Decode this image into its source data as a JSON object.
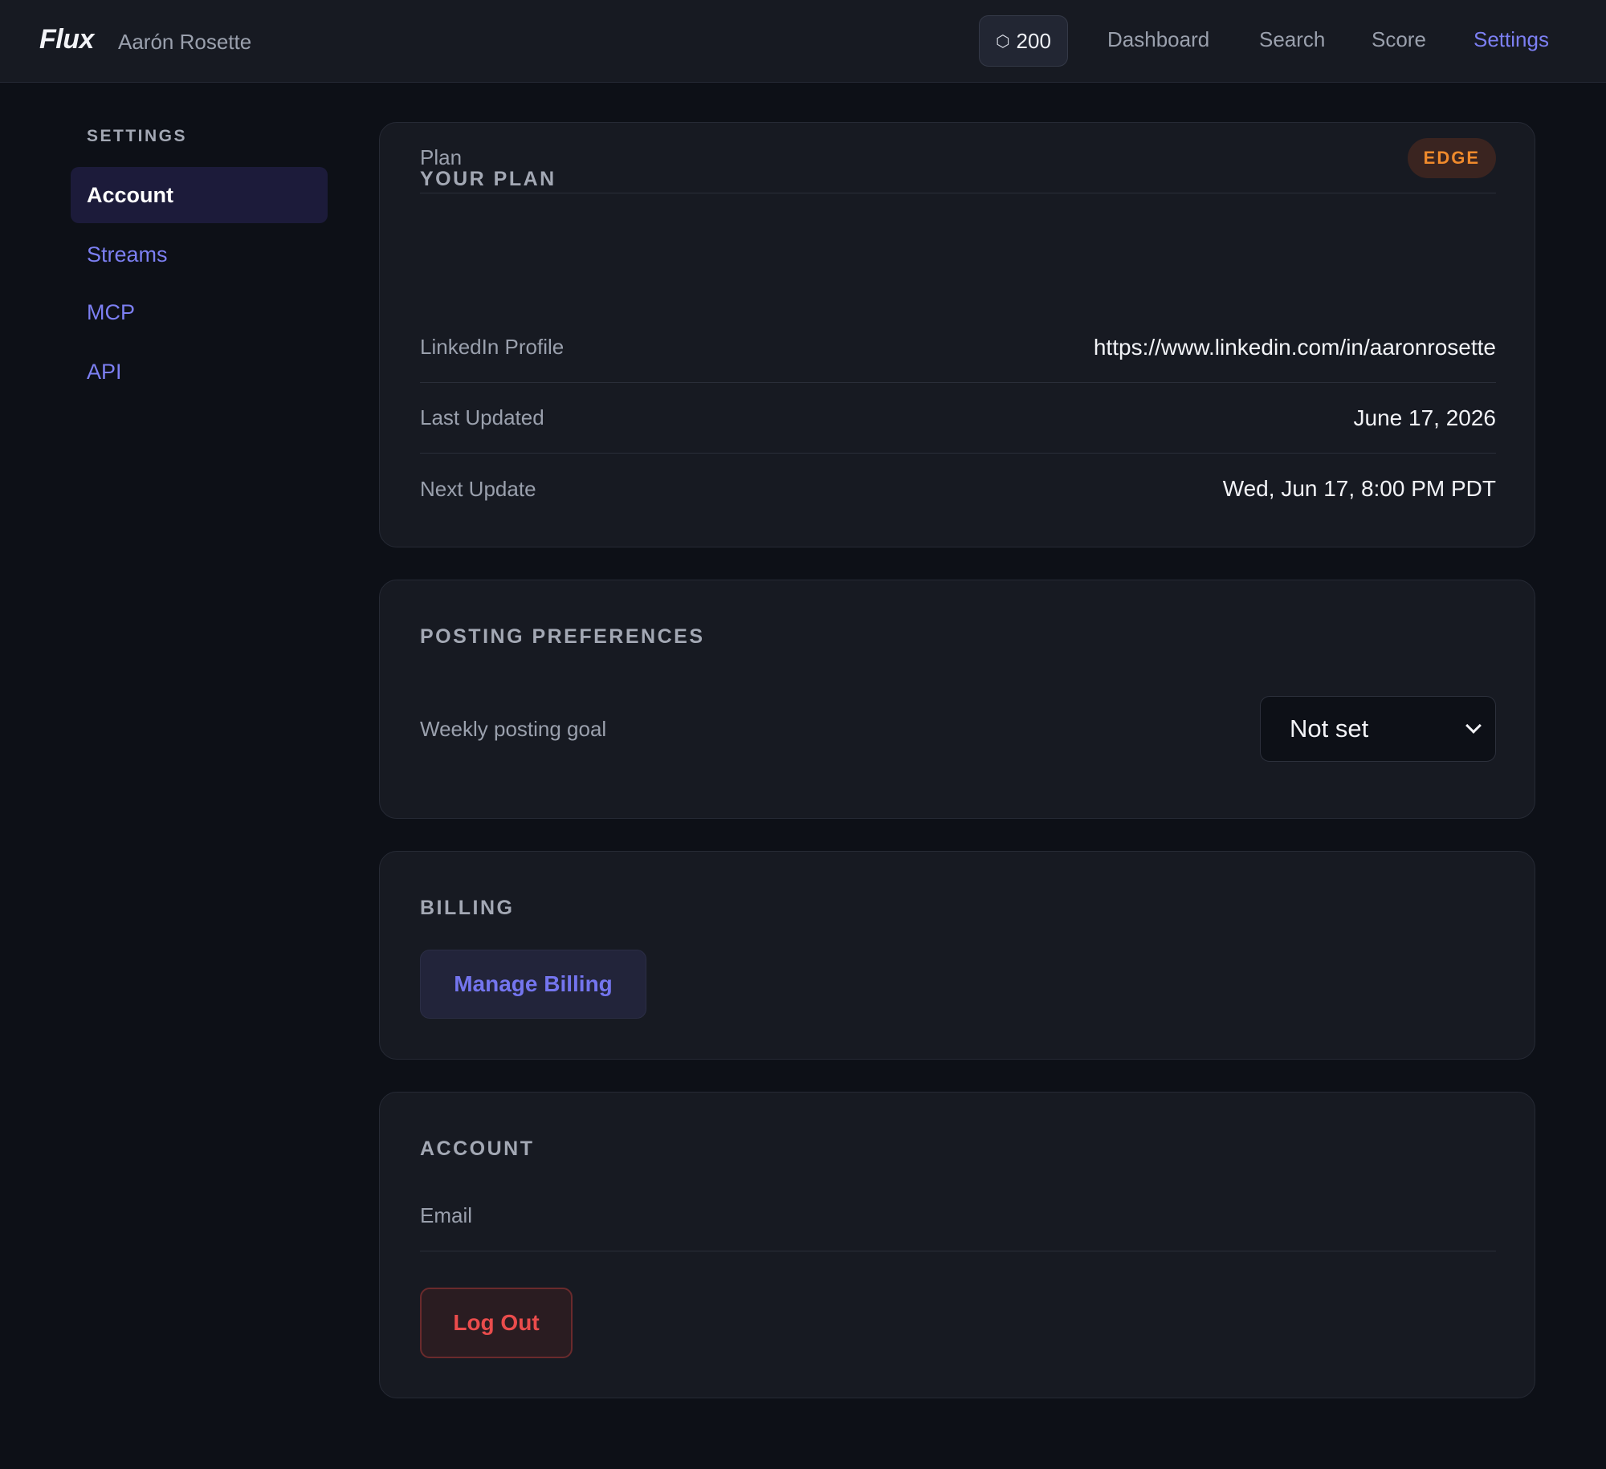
{
  "app": {
    "logo": "Flux",
    "username": "Aarón Rosette",
    "credits": "200",
    "credits_icon": "⬡"
  },
  "nav": {
    "dashboard": "Dashboard",
    "search": "Search",
    "score": "Score",
    "settings": "Settings"
  },
  "sidebar": {
    "heading": "SETTINGS",
    "items": [
      {
        "label": "Account",
        "active": true
      },
      {
        "label": "Streams",
        "active": false
      },
      {
        "label": "MCP",
        "active": false
      },
      {
        "label": "API",
        "active": false
      }
    ]
  },
  "plan": {
    "title": "YOUR PLAN",
    "rows": [
      {
        "label": "Plan",
        "value": "EDGE"
      },
      {
        "label": "LinkedIn Profile",
        "value": "https://www.linkedin.com/in/aaronrosette"
      },
      {
        "label": "Last Updated",
        "value": "June 17, 2026"
      },
      {
        "label": "Next Update",
        "value": "Wed, Jun 17, 8:00 PM PDT"
      }
    ]
  },
  "posting": {
    "title": "POSTING PREFERENCES",
    "goal_label": "Weekly posting goal",
    "goal_value": "Not set"
  },
  "billing": {
    "title": "BILLING",
    "button": "Manage Billing"
  },
  "account": {
    "title": "ACCOUNT",
    "email_label": "Email",
    "email_value": "",
    "logout": "Log Out"
  },
  "colors": {
    "accent": "#7c7ff2",
    "badge_text": "#f08a2c",
    "danger": "#ea4c4c",
    "background": "#0d1017",
    "card": "#171a22"
  }
}
